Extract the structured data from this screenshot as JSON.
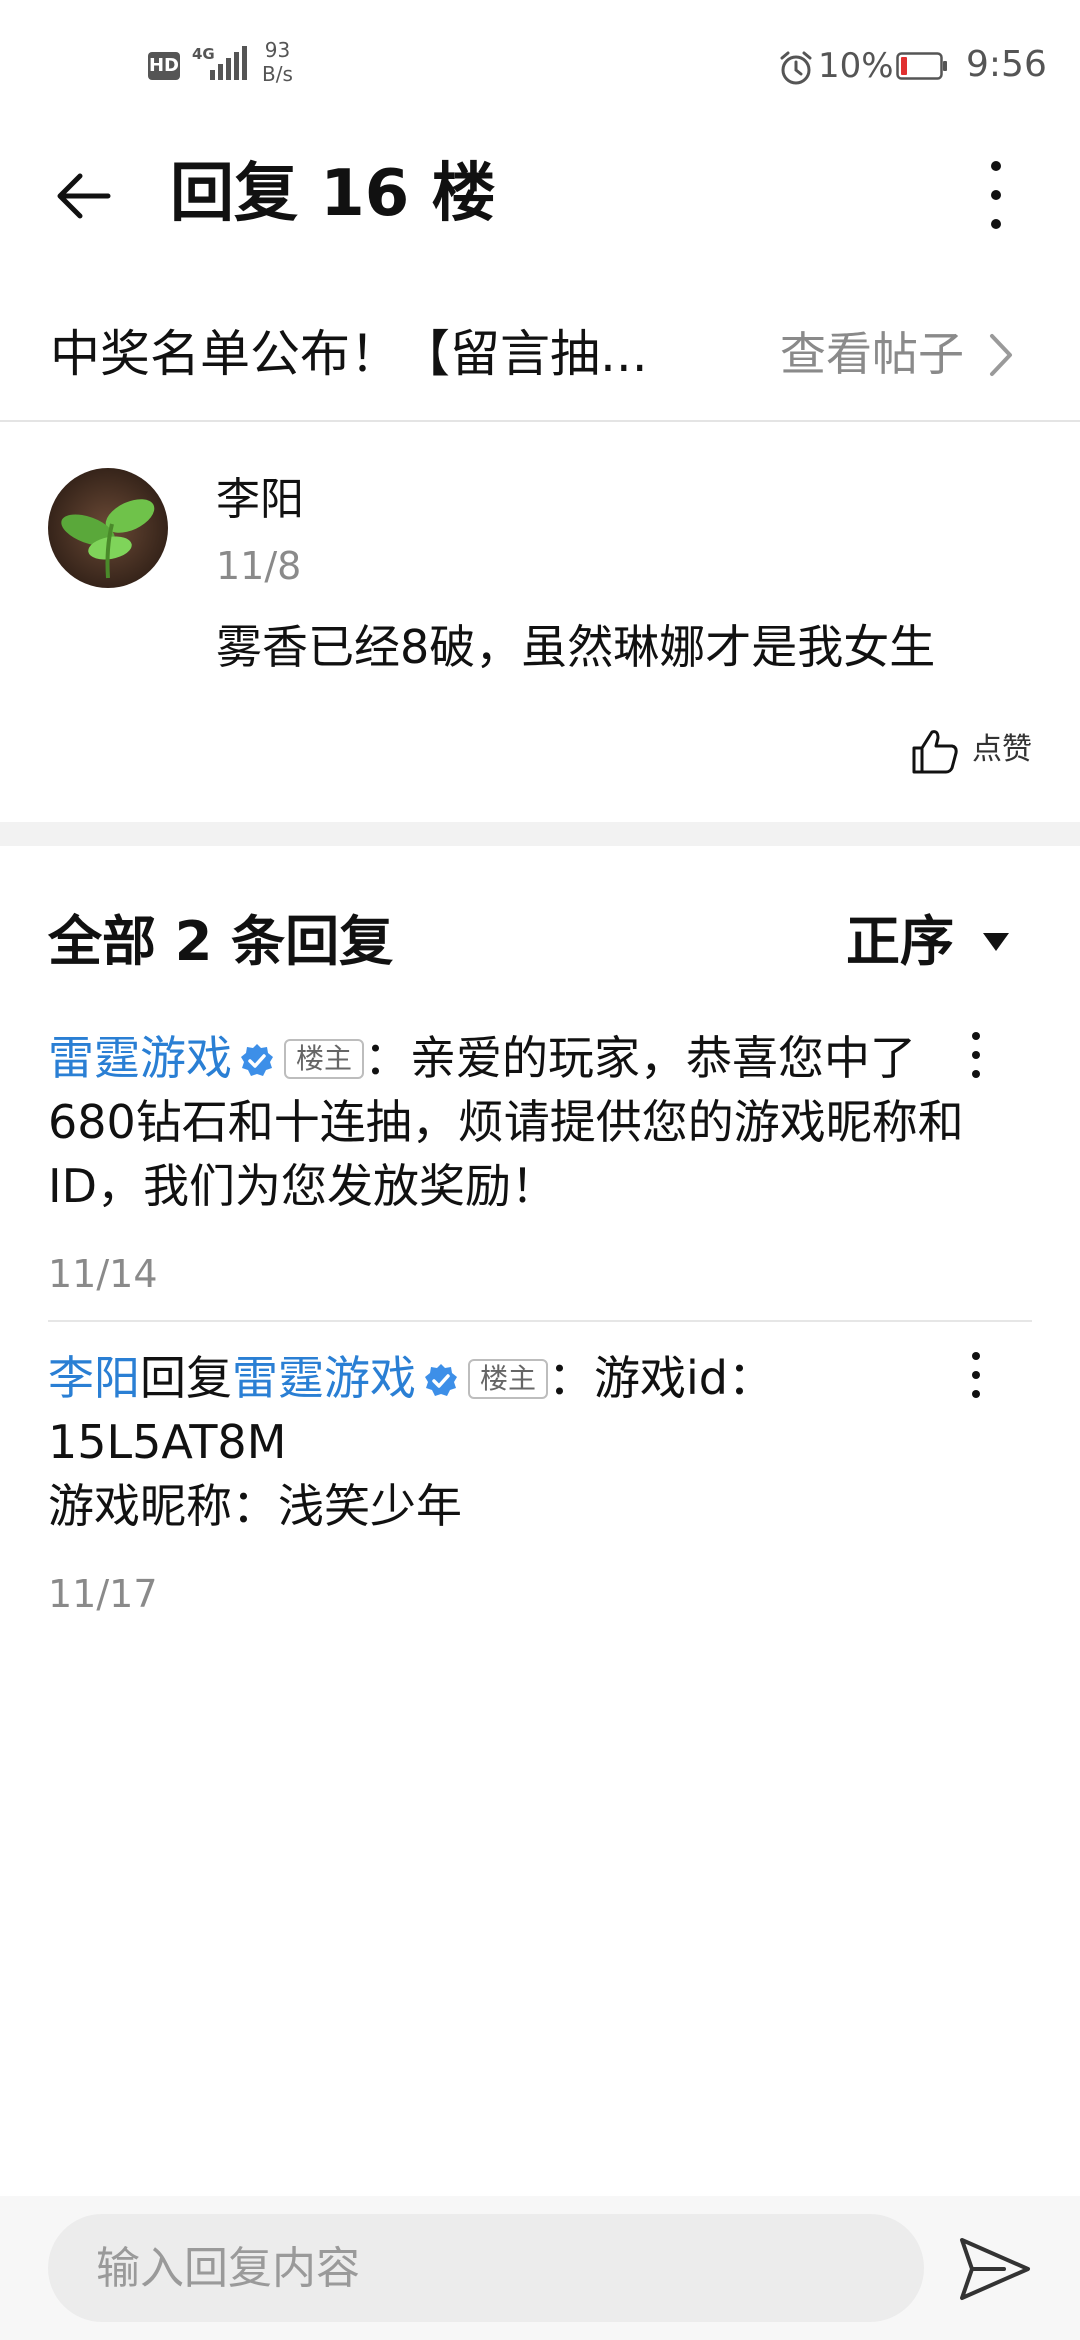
{
  "status_bar": {
    "hd": "HD",
    "network": "4G",
    "speed_value": "93",
    "speed_unit": "B/s",
    "battery_percent": "10%",
    "time": "9:56"
  },
  "header": {
    "title": "回复 16 楼"
  },
  "thread": {
    "title": "中奖名单公布！【留言抽...",
    "view_post_label": "查看帖子"
  },
  "floor_post": {
    "author": "李阳",
    "date": "11/8",
    "content": "雾香已经8破，虽然琳娜才是我女生",
    "like_label": "点赞"
  },
  "replies": {
    "count_label": "全部 2 条回复",
    "sort_label": "正序",
    "items": [
      {
        "author": "雷霆游戏",
        "badge": "楼主",
        "separator": "：",
        "content": "亲爱的玩家，恭喜您中了680钻石和十连抽，烦请提供您的游戏昵称和ID，我们为您发放奖励！",
        "date": "11/14"
      },
      {
        "author": "李阳",
        "reply_word": "回复",
        "target": "雷霆游戏",
        "badge": "楼主",
        "separator": "：",
        "content_line1": "游戏id：15L5AT8M",
        "content_line2": "游戏昵称：浅笑少年",
        "date": "11/17"
      }
    ]
  },
  "input": {
    "placeholder": "输入回复内容"
  },
  "colors": {
    "link": "#2a7fd4",
    "verified": "#3d8fe8",
    "battery_low": "#e03030",
    "muted": "#8a8a8a"
  },
  "icons": {
    "back": "back-arrow-icon",
    "more": "more-vertical-icon",
    "chevron": "chevron-right-icon",
    "like": "thumbs-up-icon",
    "sort": "caret-down-icon",
    "verified": "verified-check-icon",
    "send": "send-icon",
    "alarm": "alarm-clock-icon"
  }
}
